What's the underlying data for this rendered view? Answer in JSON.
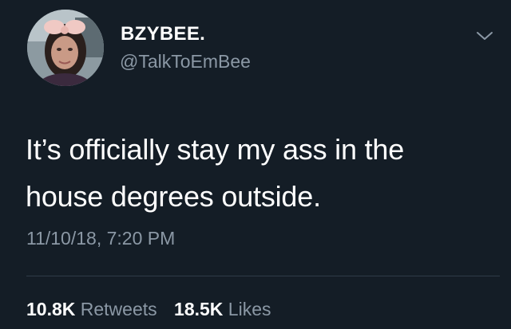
{
  "tweet": {
    "author": {
      "display_name": "BZYBEE.",
      "handle": "@TalkToEmBee",
      "avatar_icon": "profile-photo"
    },
    "menu_icon": "chevron-down-icon",
    "text_lines": [
      "It’s officially stay my ass in the",
      "house degrees outside."
    ],
    "timestamp": "11/10/18, 7:20 PM",
    "stats": {
      "retweets_count": "10.8K",
      "retweets_label": "Retweets",
      "likes_count": "18.5K",
      "likes_label": "Likes"
    }
  },
  "colors": {
    "background": "#141d26",
    "primary_text": "#ffffff",
    "secondary_text": "#8b98a5",
    "divider": "#2f3b47"
  }
}
